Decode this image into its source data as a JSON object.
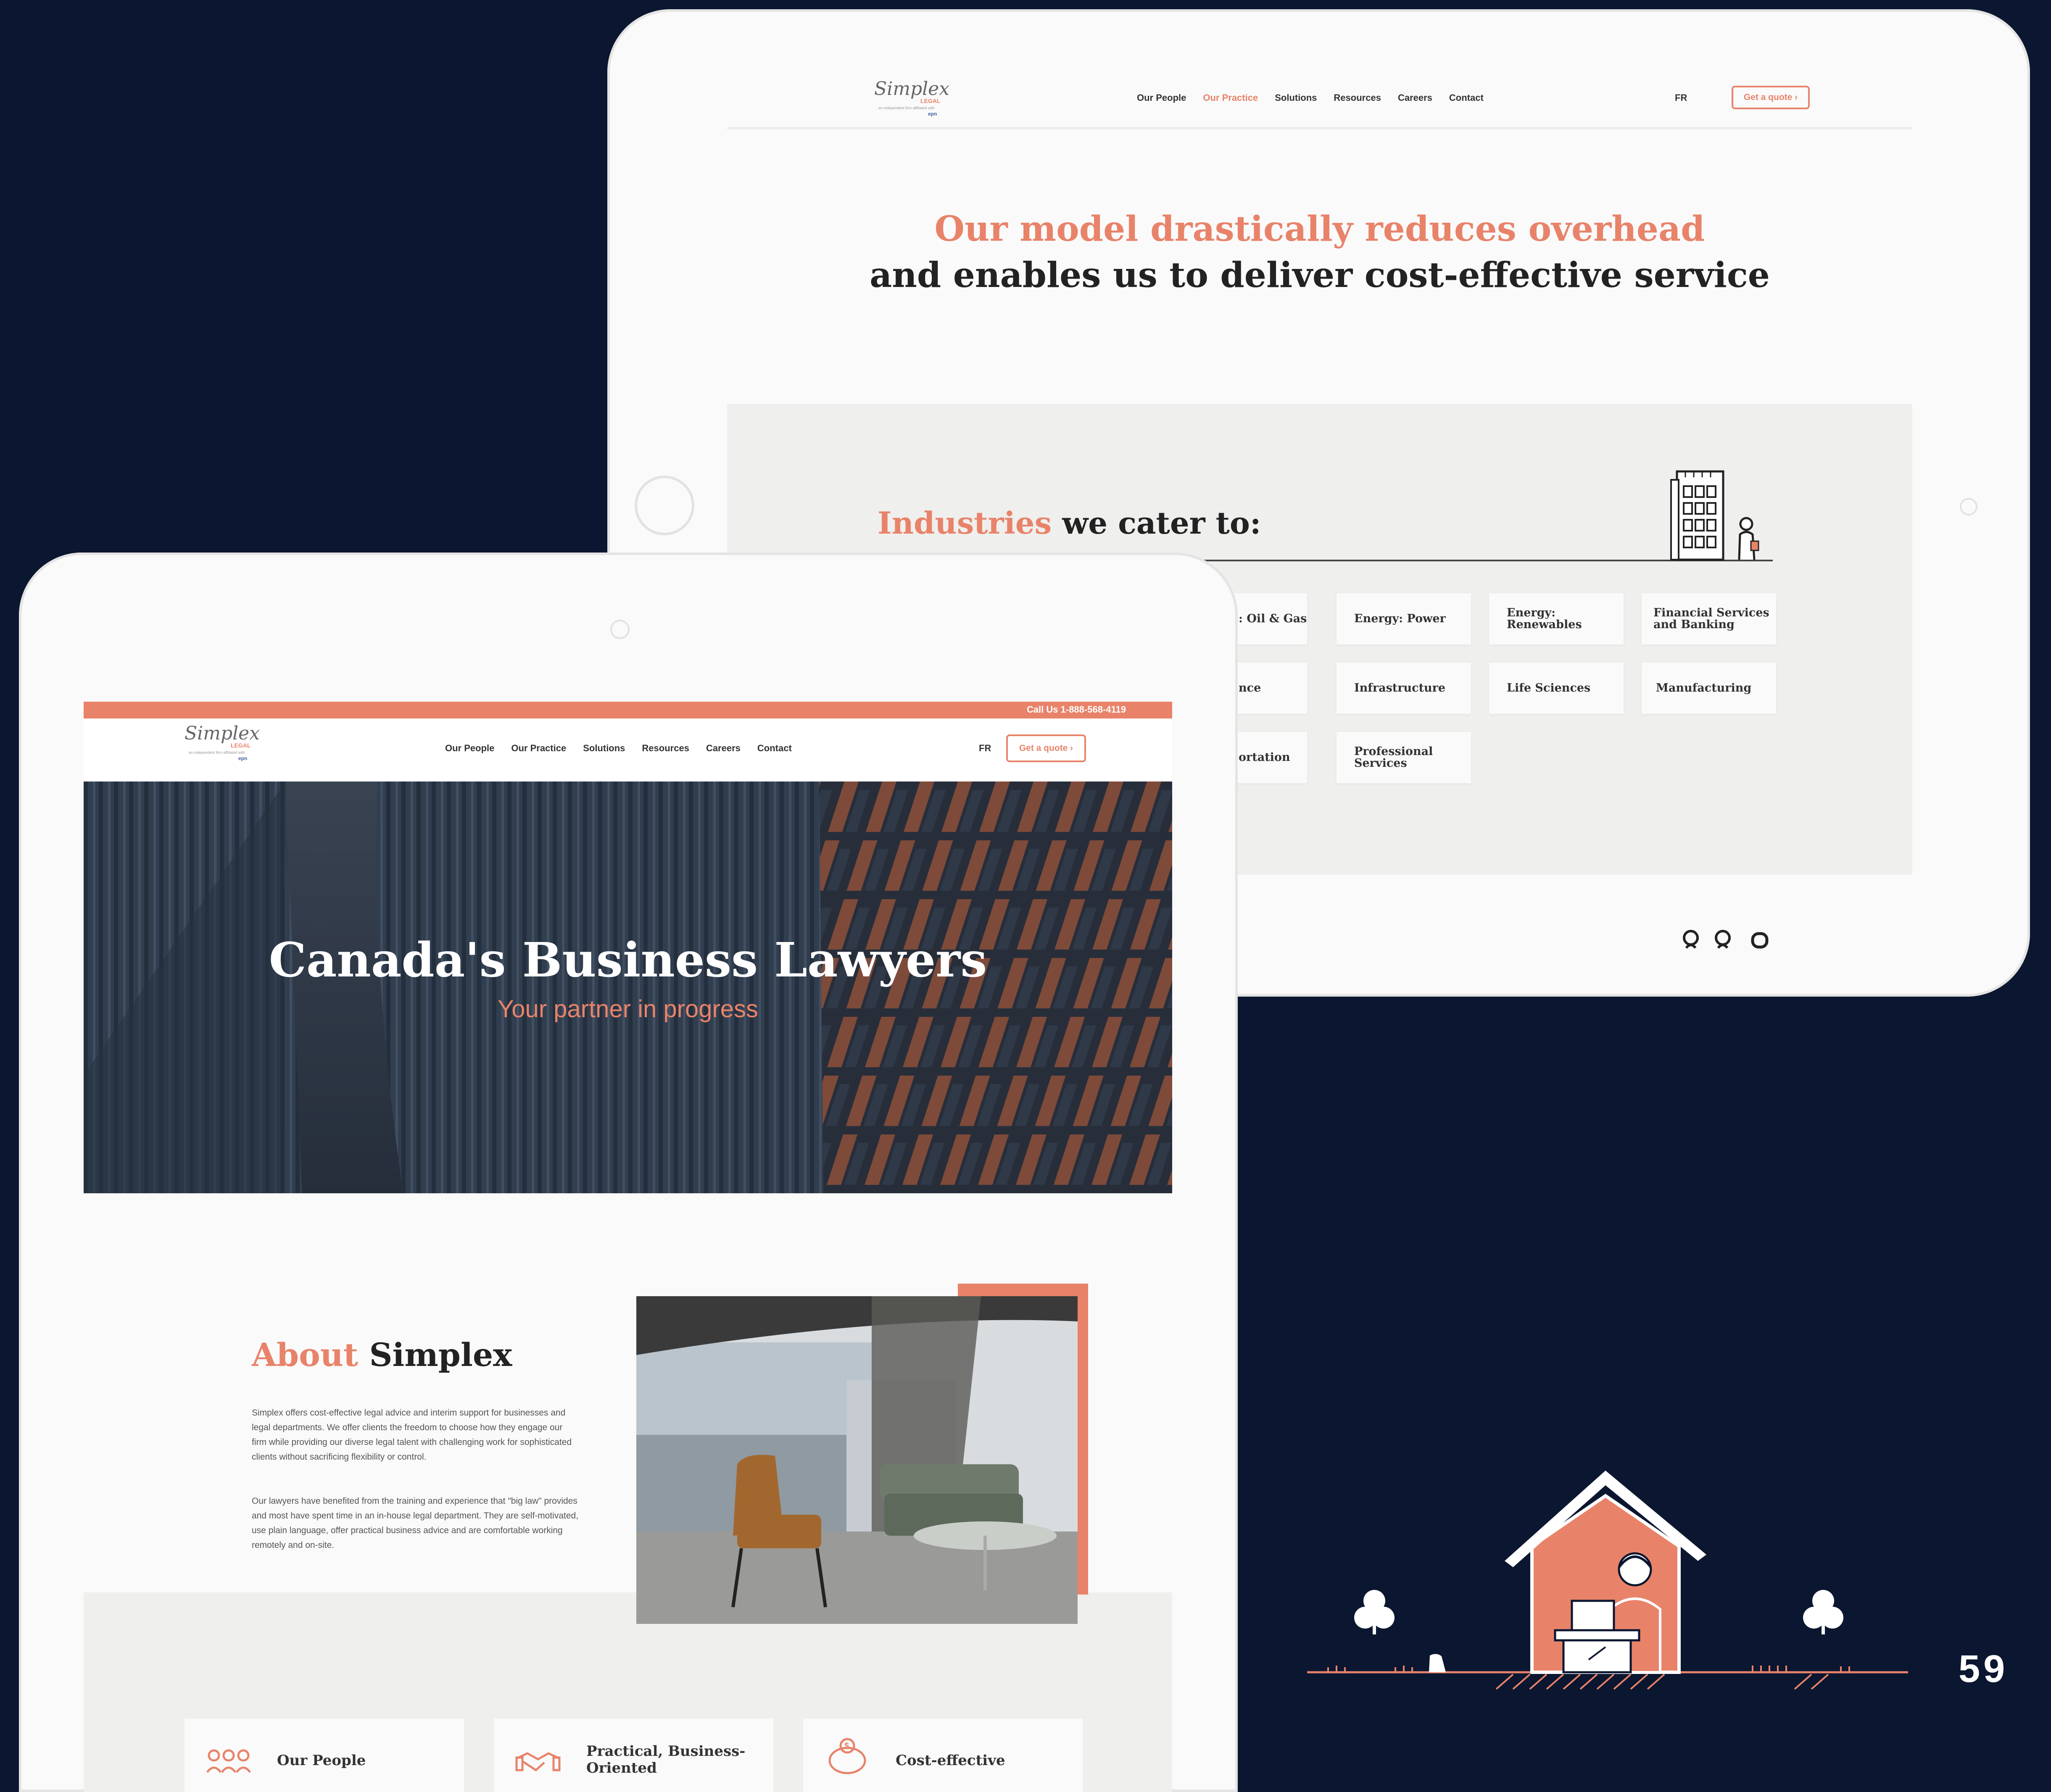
{
  "brand": {
    "logo_word": "Simplex",
    "logo_legal": "LEGAL",
    "logo_sub": "an independent firm affiliated with",
    "logo_affiliate": "epn",
    "accent": "#e8836a",
    "background": "#0b1630"
  },
  "back_page": {
    "nav": {
      "items": [
        "Our People",
        "Our Practice",
        "Solutions",
        "Resources",
        "Careers",
        "Contact"
      ],
      "active": "Our Practice",
      "lang": "FR",
      "quote_button": "Get a quote ›"
    },
    "model_line_1": "Our model drastically reduces overhead",
    "model_line_2": "and enables us to deliver cost-effective service",
    "industries": {
      "title_highlight": "Industries",
      "title_rest": " we cater to:",
      "cards": [
        ": Oil & Gas",
        "Energy: Power",
        "Energy: Renewables",
        "Financial Services and Banking",
        "nce",
        "Infrastructure",
        "Life Sciences",
        "Manufacturing",
        "ortation",
        "Professional Services"
      ]
    }
  },
  "front_page": {
    "call_us": "Call Us 1-888-568-4119",
    "nav": {
      "items": [
        "Our People",
        "Our Practice",
        "Solutions",
        "Resources",
        "Careers",
        "Contact"
      ],
      "lang": "FR",
      "quote_button": "Get a quote ›"
    },
    "hero_title": "Canada's Business Lawyers",
    "hero_subtitle": "Your partner in progress",
    "about": {
      "title_highlight": "About",
      "title_rest": " Simplex",
      "p1": "Simplex offers cost-effective legal advice and interim support for businesses and legal departments. We offer clients the freedom to choose how they engage our firm while providing our diverse legal talent with challenging work for sophisticated clients without sacrificing flexibility or control.",
      "p2": "Our lawyers have benefited from the training and experience that \"big law\" provides and most have spent time in an in-house legal department. They are self-motivated, use plain language, offer practical business advice and are comfortable working remotely and on-site."
    },
    "features": [
      "Our People",
      "Practical, Business-Oriented",
      "Cost-effective"
    ]
  },
  "page_number": "59"
}
